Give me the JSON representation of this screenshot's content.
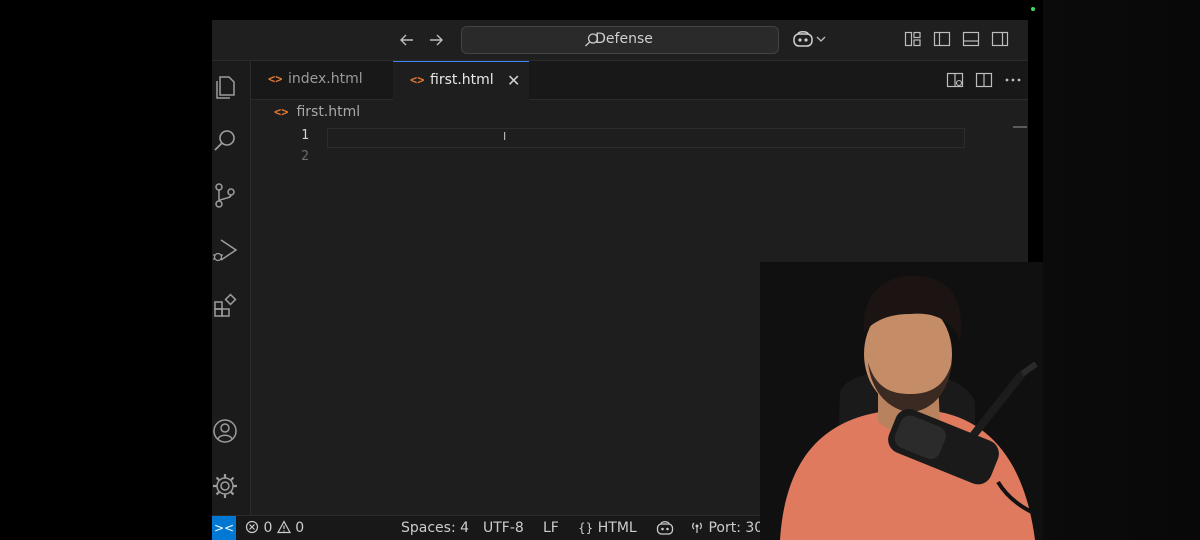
{
  "titlebar": {
    "search_label": "Defense",
    "icons": [
      "arrow-left-icon",
      "arrow-right-icon",
      "search-icon",
      "copilot-icon",
      "chevron-down-icon",
      "customize-layout-icon",
      "toggle-sidebar-icon",
      "toggle-panel-icon",
      "toggle-secondary-sidebar-icon"
    ]
  },
  "activity_bar": {
    "items": [
      "explorer-icon",
      "search-icon",
      "source-control-icon",
      "run-debug-icon",
      "extensions-icon",
      "account-icon",
      "settings-gear-icon"
    ]
  },
  "tabs": [
    {
      "label": "index.html",
      "active": false
    },
    {
      "label": "first.html",
      "active": true
    }
  ],
  "tab_icon_glyph": "<>",
  "close_glyph": "✕",
  "breadcrumb": {
    "file": "first.html"
  },
  "editor": {
    "line_numbers": [
      "1",
      "2"
    ],
    "content": ""
  },
  "statusbar": {
    "remote_glyph": "><",
    "errors": "0",
    "warnings": "0",
    "spaces": "Spaces: 4",
    "encoding": "UTF-8",
    "eol": "LF",
    "language_glyph": "{}",
    "language": "HTML",
    "port": "Port: 30"
  },
  "colors": {
    "accent": "#0078d4",
    "editor_bg": "#1e1e1e",
    "html_icon": "#e37933",
    "status_online": "#3ddc5a"
  }
}
